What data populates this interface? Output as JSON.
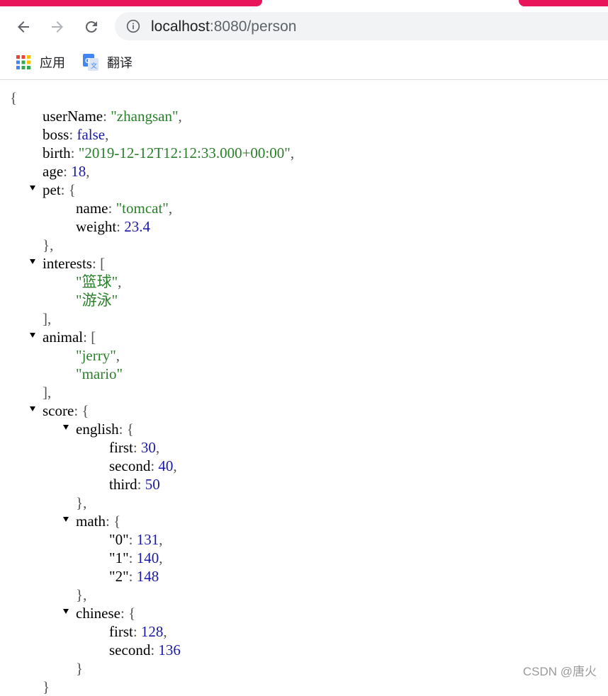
{
  "browser": {
    "url_host": "localhost",
    "url_path": ":8080/person",
    "bookmarks": [
      {
        "label": "应用",
        "icon": "apps-grid-icon"
      },
      {
        "label": "翻译",
        "icon": "google-translate-icon"
      }
    ]
  },
  "json": {
    "open_brace": "{",
    "userName_key": "userName",
    "userName_val": "\"zhangsan\"",
    "boss_key": "boss",
    "boss_val": "false",
    "birth_key": "birth",
    "birth_val": "\"2019-12-12T12:12:33.000+00:00\"",
    "age_key": "age",
    "age_val": "18",
    "pet_key": "pet",
    "pet_name_key": "name",
    "pet_name_val": "\"tomcat\"",
    "pet_weight_key": "weight",
    "pet_weight_val": "23.4",
    "interests_key": "interests",
    "interests": [
      "\"篮球\"",
      "\"游泳\""
    ],
    "animal_key": "animal",
    "animal": [
      "\"jerry\"",
      "\"mario\""
    ],
    "score_key": "score",
    "english_key": "english",
    "english_first_key": "first",
    "english_first_val": "30",
    "english_second_key": "second",
    "english_second_val": "40",
    "english_third_key": "third",
    "english_third_val": "50",
    "math_key": "math",
    "math_0_key": "\"0\"",
    "math_0_val": "131",
    "math_1_key": "\"1\"",
    "math_1_val": "140",
    "math_2_key": "\"2\"",
    "math_2_val": "148",
    "chinese_key": "chinese",
    "chinese_first_key": "first",
    "chinese_first_val": "128",
    "chinese_second_key": "second",
    "chinese_second_val": "136"
  },
  "watermark": "CSDN @唐火",
  "colors": {
    "tab_accent": "#e8155a",
    "string": "#2a7f2a",
    "number": "#1a1aa6"
  }
}
